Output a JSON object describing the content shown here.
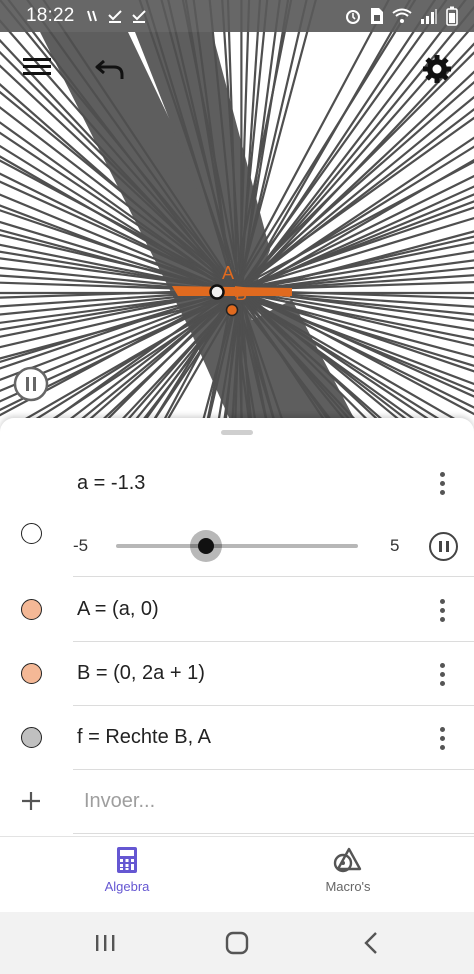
{
  "status_bar": {
    "time": "18:22",
    "left_icons": [
      "notification-icon",
      "check-icon",
      "check-icon"
    ],
    "right_icons": [
      "alarm-icon",
      "sim-icon",
      "wifi-icon",
      "signal-icon",
      "battery-icon"
    ]
  },
  "graphics_view": {
    "toolbar": {
      "menu_icon": "hamburger-menu-icon",
      "undo_icon": "undo-icon",
      "settings_icon": "gear-icon",
      "animation_icon": "pause-icon"
    },
    "points": [
      {
        "label": "A",
        "x": -1.3,
        "y": 0
      },
      {
        "label": "B",
        "x": 0,
        "y": -1.6
      }
    ],
    "colors": {
      "trace": "#5e5e5e",
      "lines": "#4f4f4f",
      "point": "#e06a1f",
      "point_fill_A": "#e8e8e8"
    }
  },
  "algebra": {
    "items": [
      {
        "name": "slider-a",
        "marble_color": "#ffffff",
        "expression": "a = -1.3",
        "slider": {
          "min": "-5",
          "max": "5",
          "value": -1.3
        }
      },
      {
        "name": "point-A",
        "marble_color": "#f4b896",
        "expression": "A = (a, 0)"
      },
      {
        "name": "point-B",
        "marble_color": "#f4b896",
        "expression": "B = (0, 2a + 1)"
      },
      {
        "name": "line-f",
        "marble_color": "#c0c0c0",
        "expression": "f = Rechte B, A"
      }
    ],
    "input": {
      "placeholder": "Invoer..."
    }
  },
  "bottom_nav": {
    "tabs": [
      {
        "label": "Algebra",
        "icon": "calculator-icon",
        "active": true,
        "color": "#6557d2"
      },
      {
        "label": "Macro's",
        "icon": "tools-icon",
        "active": false,
        "color": "#666666"
      }
    ]
  },
  "system_nav": {
    "buttons": [
      "recent-apps-icon",
      "home-icon",
      "back-icon"
    ]
  }
}
